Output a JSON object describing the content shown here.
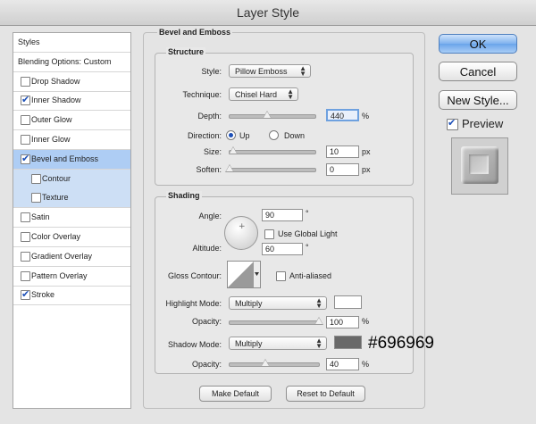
{
  "window": {
    "title": "Layer Style"
  },
  "left_panel": {
    "items": [
      {
        "label": "Styles",
        "checkbox": false,
        "checked": false
      },
      {
        "label": "Blending Options: Custom",
        "checkbox": false,
        "checked": false
      },
      {
        "label": "Drop Shadow",
        "checkbox": true,
        "checked": false
      },
      {
        "label": "Inner Shadow",
        "checkbox": true,
        "checked": true
      },
      {
        "label": "Outer Glow",
        "checkbox": true,
        "checked": false
      },
      {
        "label": "Inner Glow",
        "checkbox": true,
        "checked": false
      },
      {
        "label": "Bevel and Emboss",
        "checkbox": true,
        "checked": true,
        "selected": true
      },
      {
        "label": "Contour",
        "checkbox": true,
        "checked": false,
        "sub": true
      },
      {
        "label": "Texture",
        "checkbox": true,
        "checked": false,
        "sub": true
      },
      {
        "label": "Satin",
        "checkbox": true,
        "checked": false
      },
      {
        "label": "Color Overlay",
        "checkbox": true,
        "checked": false
      },
      {
        "label": "Gradient Overlay",
        "checkbox": true,
        "checked": false
      },
      {
        "label": "Pattern Overlay",
        "checkbox": true,
        "checked": false
      },
      {
        "label": "Stroke",
        "checkbox": true,
        "checked": true
      }
    ]
  },
  "bevel": {
    "title": "Bevel and Emboss",
    "structure": {
      "title": "Structure",
      "style_label": "Style:",
      "style_value": "Pillow Emboss",
      "technique_label": "Technique:",
      "technique_value": "Chisel Hard",
      "depth_label": "Depth:",
      "depth_value": "440",
      "depth_unit": "%",
      "direction_label": "Direction:",
      "direction_up": "Up",
      "direction_down": "Down",
      "direction_selected": "Up",
      "size_label": "Size:",
      "size_value": "10",
      "size_unit": "px",
      "soften_label": "Soften:",
      "soften_value": "0",
      "soften_unit": "px"
    },
    "shading": {
      "title": "Shading",
      "angle_label": "Angle:",
      "angle_value": "90",
      "angle_unit": "°",
      "use_global_light": "Use Global Light",
      "use_global_light_checked": false,
      "altitude_label": "Altitude:",
      "altitude_value": "60",
      "altitude_unit": "°",
      "gloss_contour_label": "Gloss Contour:",
      "anti_aliased": "Anti-aliased",
      "anti_aliased_checked": false,
      "highlight_mode_label": "Highlight Mode:",
      "highlight_mode_value": "Multiply",
      "highlight_color": "#ffffff",
      "highlight_opacity_label": "Opacity:",
      "highlight_opacity_value": "100",
      "highlight_opacity_unit": "%",
      "shadow_mode_label": "Shadow Mode:",
      "shadow_mode_value": "Multiply",
      "shadow_color": "#696969",
      "shadow_opacity_label": "Opacity:",
      "shadow_opacity_value": "40",
      "shadow_opacity_unit": "%"
    },
    "make_default": "Make Default",
    "reset_to_default": "Reset to Default"
  },
  "levels": {
    "depth_fraction": 0.44,
    "size_fraction": 0.04,
    "soften_fraction": 0.0,
    "highlight_opacity_fraction": 1.0,
    "shadow_opacity_fraction": 0.4
  },
  "buttons": {
    "ok": "OK",
    "cancel": "Cancel",
    "new_style": "New Style...",
    "preview": "Preview",
    "preview_checked": true
  },
  "annotation": {
    "hex_label": "#696969"
  }
}
